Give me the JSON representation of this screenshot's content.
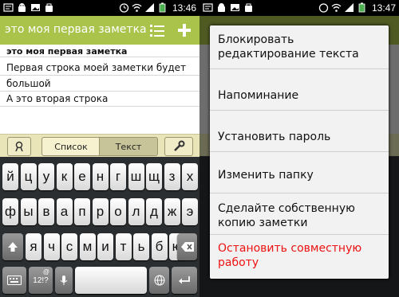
{
  "left": {
    "status": {
      "time": "13:46"
    },
    "titlebar": {
      "title": "это моя первая заметка"
    },
    "note": {
      "title_line": "это моя первая заметка",
      "line1": "Первая строка моей заметки будет",
      "line2": "большой",
      "line3": "А это вторая строка"
    },
    "mode": {
      "list_label": "Список",
      "text_label": "Текст"
    },
    "keyboard": {
      "row1": [
        "й",
        "ц",
        "у",
        "к",
        "е",
        "н",
        "г",
        "ш",
        "щ",
        "з",
        "х"
      ],
      "row2": [
        "ф",
        "ы",
        "в",
        "а",
        "п",
        "р",
        "о",
        "л",
        "д",
        "ж",
        "э"
      ],
      "row3": [
        "я",
        "ч",
        "с",
        "м",
        "и",
        "т",
        "ь",
        "б",
        "ю"
      ],
      "sym_label": "12!?",
      "sym_sub": "@"
    }
  },
  "right": {
    "status": {
      "time": "13:47"
    },
    "menu": {
      "items": [
        {
          "label": "Блокировать редактирование текста"
        },
        {
          "label": "Напоминание"
        },
        {
          "label": "Установить пароль"
        },
        {
          "label": "Изменить папку"
        },
        {
          "label": "Сделайте собственную копию заметки"
        },
        {
          "label": "Остановить совместную работу"
        }
      ]
    }
  },
  "colors": {
    "accent_green": "#a9c34b",
    "danger_red": "#ee1111",
    "mode_bar": "#e9e5b8"
  }
}
